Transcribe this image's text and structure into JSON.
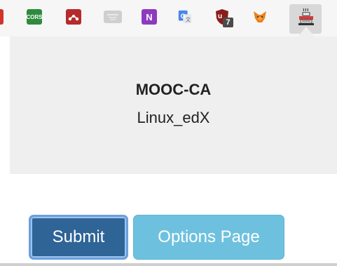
{
  "toolbar": {
    "extensions": [
      {
        "name": "red-edge-icon"
      },
      {
        "name": "cors-extension-icon",
        "label": "CORS"
      },
      {
        "name": "mendeley-icon"
      },
      {
        "name": "gray-card-icon"
      },
      {
        "name": "onenote-icon",
        "label": "N"
      },
      {
        "name": "google-translate-icon"
      },
      {
        "name": "ublock-icon",
        "badge": "7"
      },
      {
        "name": "metamask-fox-icon"
      },
      {
        "name": "coffee-typewriter-icon",
        "active": true
      }
    ]
  },
  "popup": {
    "title": "MOOC-CA",
    "subtitle": "Linux_edX"
  },
  "actions": {
    "submit_label": "Submit",
    "options_label": "Options Page"
  },
  "colors": {
    "submit_bg": "#2f6497",
    "options_bg": "#6ec1de",
    "panel_bg": "#efefef"
  }
}
